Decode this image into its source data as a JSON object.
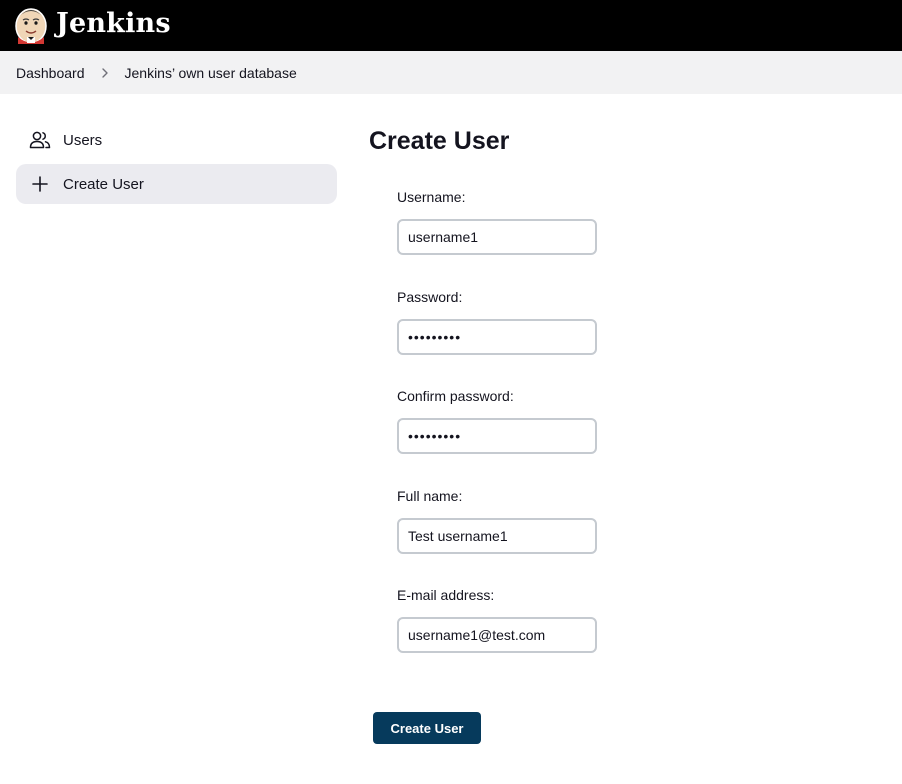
{
  "header": {
    "brand": "Jenkins",
    "logo_icon": "jenkins-butler-logo-icon"
  },
  "breadcrumb": {
    "items": [
      {
        "label": "Dashboard"
      },
      {
        "label": "Jenkins’ own user database"
      }
    ],
    "separator_icon": "chevron-right-icon"
  },
  "sidebar": {
    "items": [
      {
        "label": "Users",
        "icon": "users-icon",
        "active": false
      },
      {
        "label": "Create User",
        "icon": "plus-icon",
        "active": true
      }
    ]
  },
  "main": {
    "title": "Create User",
    "fields": [
      {
        "label": "Username:",
        "value": "username1",
        "type": "text"
      },
      {
        "label": "Password:",
        "value": "password1",
        "type": "password"
      },
      {
        "label": "Confirm password:",
        "value": "password1",
        "type": "password"
      },
      {
        "label": "Full name:",
        "value": "Test username1",
        "type": "text"
      },
      {
        "label": "E-mail address:",
        "value": "username1@test.com",
        "type": "text"
      }
    ],
    "submit_label": "Create User"
  },
  "colors": {
    "header_bg": "#000000",
    "breadcrumb_bg": "#f2f2f3",
    "active_task_bg": "#ebebf0",
    "input_border": "#c5cad0",
    "primary_button": "#063a5c"
  }
}
